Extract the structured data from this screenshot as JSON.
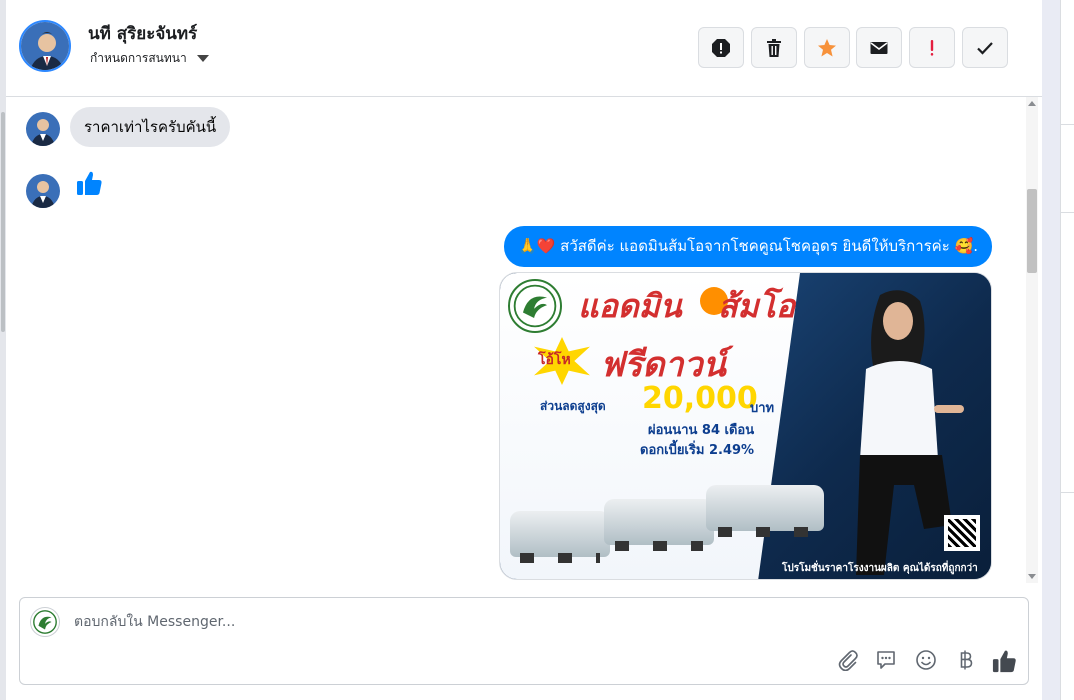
{
  "colors": {
    "messenger_blue": "#0084ff",
    "bubble_gray": "#e4e6eb",
    "star_orange": "#f7923b",
    "important_red": "#e41e3f"
  },
  "header": {
    "name": "นที สุริยะจันทร์",
    "assign_label": "กำหนดการสนทนา",
    "actions": [
      {
        "icon": "spam-icon"
      },
      {
        "icon": "trash-icon"
      },
      {
        "icon": "star-icon"
      },
      {
        "icon": "envelope-icon"
      },
      {
        "icon": "exclamation-icon"
      },
      {
        "icon": "checkmark-icon"
      }
    ]
  },
  "messages": {
    "incoming_text": "ราคาเท่าไรครับคันนี้",
    "incoming_like_icon": "thumbs-up-icon",
    "outgoing_text": "🙏❤️ สวัสดีค่ะ แอดมินส้มโอจากโชคคูณโชคอุดร ยินดีให้บริการค่ะ 🥰.",
    "promo": {
      "title_left": "แอดมิน",
      "title_right": "ส้มโอ",
      "badge": "โอ้โห",
      "headline": "ฟรีดาวน์",
      "discount_label": "ส่วนลดสูงสุด",
      "discount_amount": "20,000",
      "discount_unit": "บาท",
      "installment": "ผ่อนนาน 84 เดือน",
      "rate": "ดอกเบี้ยเริ่ม 2.49%",
      "footer": "โปรโมชั่นราคาโรงงานผลิต คุณได้รถที่ถูกกว่า"
    }
  },
  "composer": {
    "placeholder": "ตอบกลับใน Messenger...",
    "tools": [
      "paperclip-icon",
      "speech-bubble-icon",
      "emoji-icon",
      "baht-icon",
      "thumbs-up-icon"
    ]
  }
}
